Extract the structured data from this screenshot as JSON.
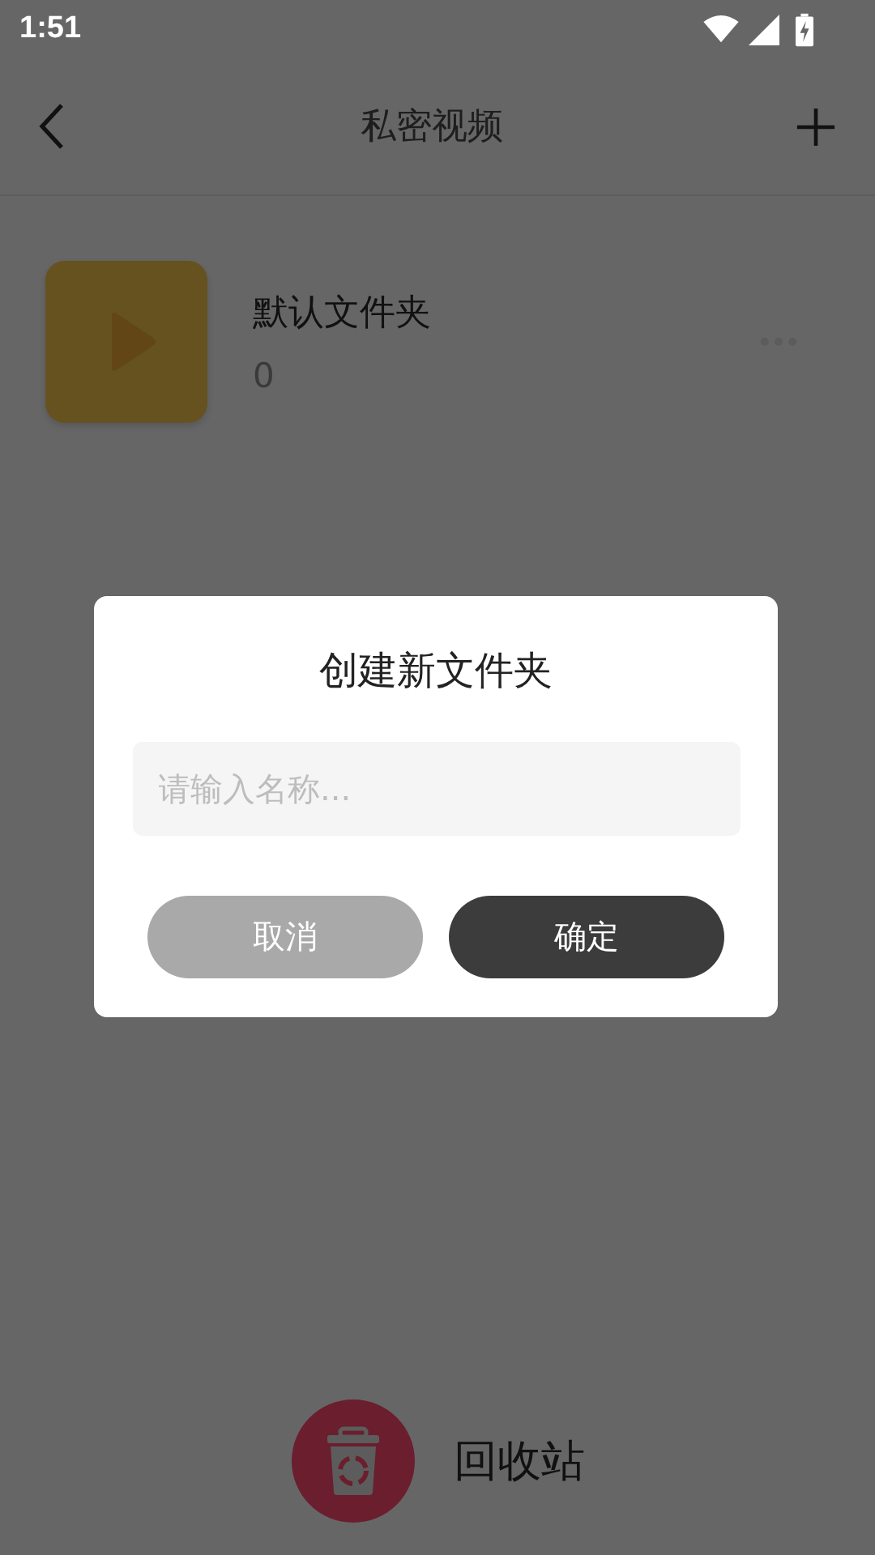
{
  "status_bar": {
    "time": "1:51"
  },
  "toolbar": {
    "title": "私密视频"
  },
  "folders": [
    {
      "name": "默认文件夹",
      "count": "0"
    }
  ],
  "recycle_bin": {
    "label": "回收站"
  },
  "dialog": {
    "title": "创建新文件夹",
    "name_field": {
      "placeholder": "请输入名称..."
    },
    "buttons": [
      {
        "label": "取消",
        "kind": "cancel"
      },
      {
        "label": "确定",
        "kind": "confirm"
      }
    ]
  }
}
